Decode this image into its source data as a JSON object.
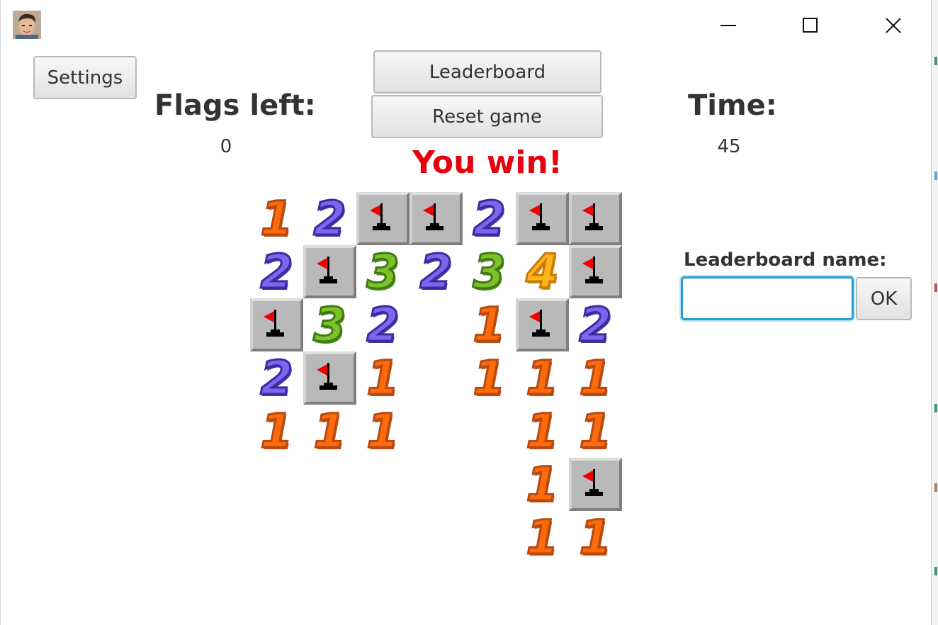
{
  "window": {
    "caption": {
      "minimize_icon": "minimize-icon",
      "maximize_icon": "maximize-icon",
      "close_icon": "close-icon"
    }
  },
  "toolbar": {
    "settings_label": "Settings",
    "leaderboard_label": "Leaderboard",
    "reset_label": "Reset game"
  },
  "stats": {
    "flags_label": "Flags left:",
    "flags_value": "0",
    "time_label": "Time:",
    "time_value": "45"
  },
  "status": {
    "message": "You win!",
    "color": "#e8000c"
  },
  "leaderboard_entry": {
    "label": "Leaderboard name:",
    "value": "",
    "ok_label": "OK"
  },
  "board": {
    "rows": [
      [
        "1",
        "2",
        "F",
        "F",
        "2",
        "F",
        "F"
      ],
      [
        "2",
        "F",
        "3",
        "2",
        "3",
        "4",
        "F"
      ],
      [
        "F",
        "3",
        "2",
        "",
        "1",
        "F",
        "2"
      ],
      [
        "2",
        "F",
        "1",
        "",
        "1",
        "1",
        "1"
      ],
      [
        "1",
        "1",
        "1",
        "",
        "",
        "1",
        "1"
      ],
      [
        "",
        "",
        "",
        "",
        "",
        "1",
        "F"
      ],
      [
        "",
        "",
        "",
        "",
        "",
        "1",
        "1"
      ]
    ],
    "number_colors": {
      "1": "#ff6a0a",
      "2": "#7c66ee",
      "3": "#7dc22b",
      "4": "#ffb21a"
    }
  }
}
